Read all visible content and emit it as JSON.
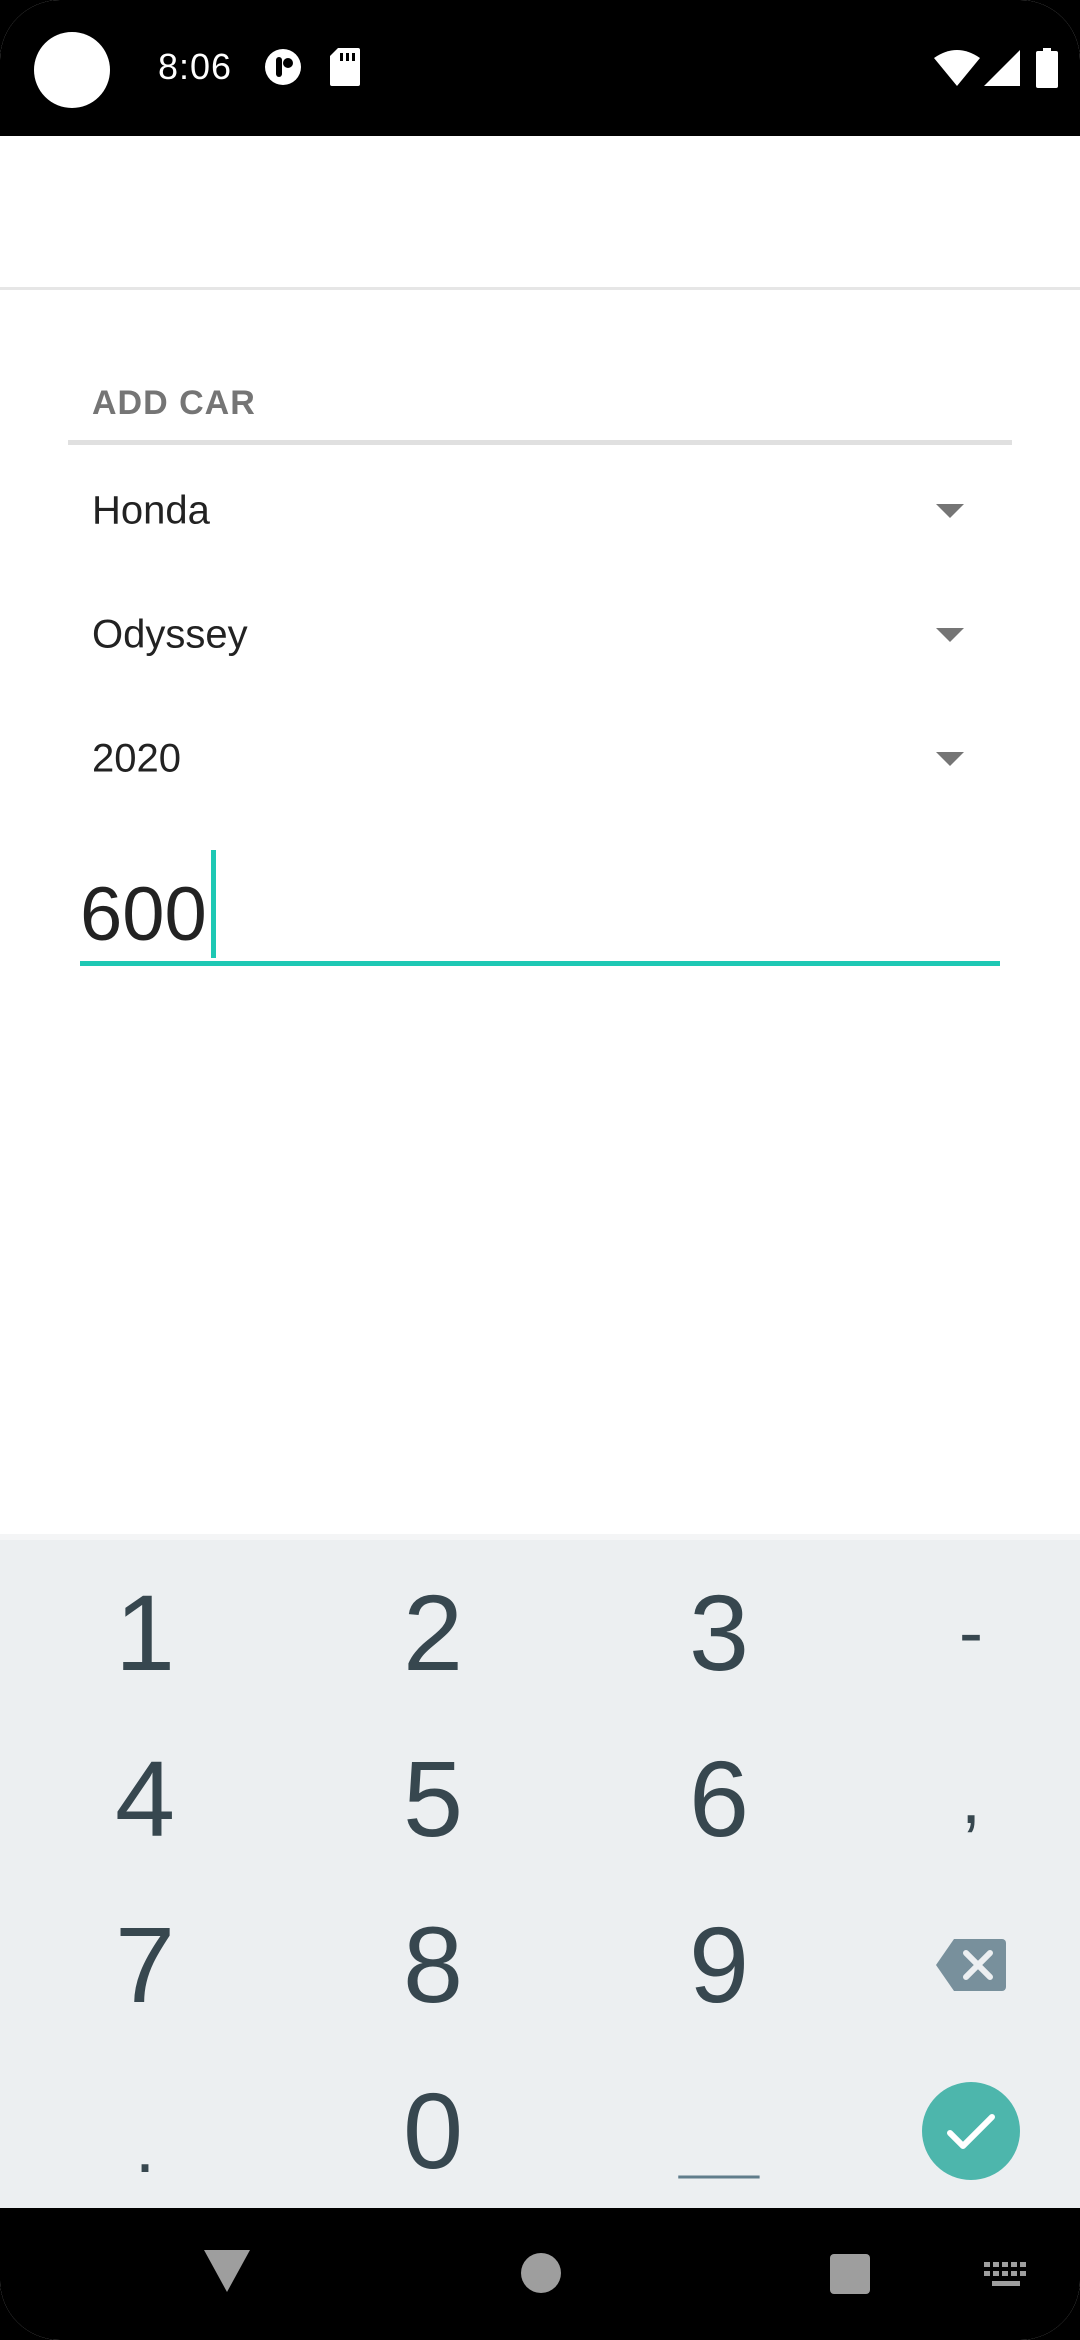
{
  "status_bar": {
    "time": "8:06",
    "icons": [
      "app-notification-icon",
      "sd-card-icon",
      "wifi-icon",
      "cell-signal-icon",
      "battery-icon"
    ]
  },
  "form": {
    "section_title": "ADD CAR",
    "make": "Honda",
    "model": "Odyssey",
    "year": "2020",
    "mileage_value": "600"
  },
  "keyboard": {
    "keys": {
      "k1": "1",
      "k2": "2",
      "k3": "3",
      "dash": "-",
      "k4": "4",
      "k5": "5",
      "k6": "6",
      "comma": ",",
      "k7": "7",
      "k8": "8",
      "k9": "9",
      "period": ".",
      "k0": "0",
      "space": "___"
    }
  },
  "colors": {
    "accent": "#1ec8b4",
    "enter_key": "#4db6ac",
    "keyboard_bg": "#eceff1",
    "key_text": "#37474f"
  }
}
